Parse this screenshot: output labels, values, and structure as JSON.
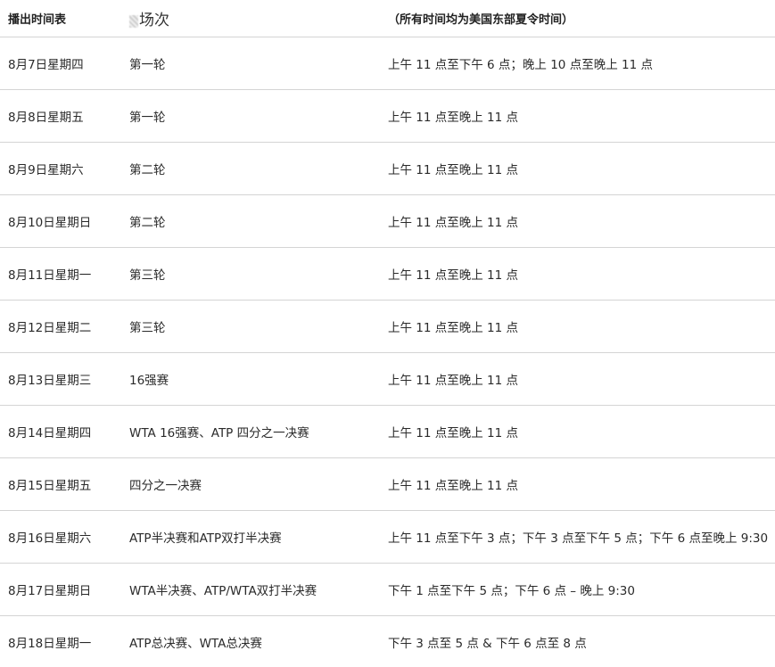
{
  "table": {
    "headers": {
      "date": "播出时间表",
      "round": "场次",
      "time": "（所有时间均为美国东部夏令时间）"
    },
    "rows": [
      {
        "date": "8月7日星期四",
        "round": "第一轮",
        "time": "上午 11 点至下午 6 点；晚上 10 点至晚上 11 点"
      },
      {
        "date": "8月8日星期五",
        "round": "第一轮",
        "time": "上午 11 点至晚上 11 点"
      },
      {
        "date": "8月9日星期六",
        "round": "第二轮",
        "time": "上午 11 点至晚上 11 点"
      },
      {
        "date": "8月10日星期日",
        "round": "第二轮",
        "time": "上午 11 点至晚上 11 点"
      },
      {
        "date": "8月11日星期一",
        "round": "第三轮",
        "time": "上午 11 点至晚上 11 点"
      },
      {
        "date": "8月12日星期二",
        "round": "第三轮",
        "time": "上午 11 点至晚上 11 点"
      },
      {
        "date": "8月13日星期三",
        "round": "16强赛",
        "time": "上午 11 点至晚上 11 点"
      },
      {
        "date": "8月14日星期四",
        "round": "WTA 16强赛、ATP 四分之一决赛",
        "time": "上午 11 点至晚上 11 点"
      },
      {
        "date": "8月15日星期五",
        "round": "四分之一决赛",
        "time": "上午 11 点至晚上 11 点"
      },
      {
        "date": "8月16日星期六",
        "round": "ATP半决赛和ATP双打半决赛",
        "time": "上午 11 点至下午 3 点；下午 3 点至下午 5 点；下午 6 点至晚上 9:30"
      },
      {
        "date": "8月17日星期日",
        "round": "WTA半决赛、ATP/WTA双打半决赛",
        "time": "下午 1 点至下午 5 点；下午 6 点 – 晚上 9:30"
      },
      {
        "date": "8月18日星期一",
        "round": "ATP总决赛、WTA总决赛",
        "time": "下午 3 点至 5 点 & 下午 6 点至 8 点"
      }
    ]
  }
}
